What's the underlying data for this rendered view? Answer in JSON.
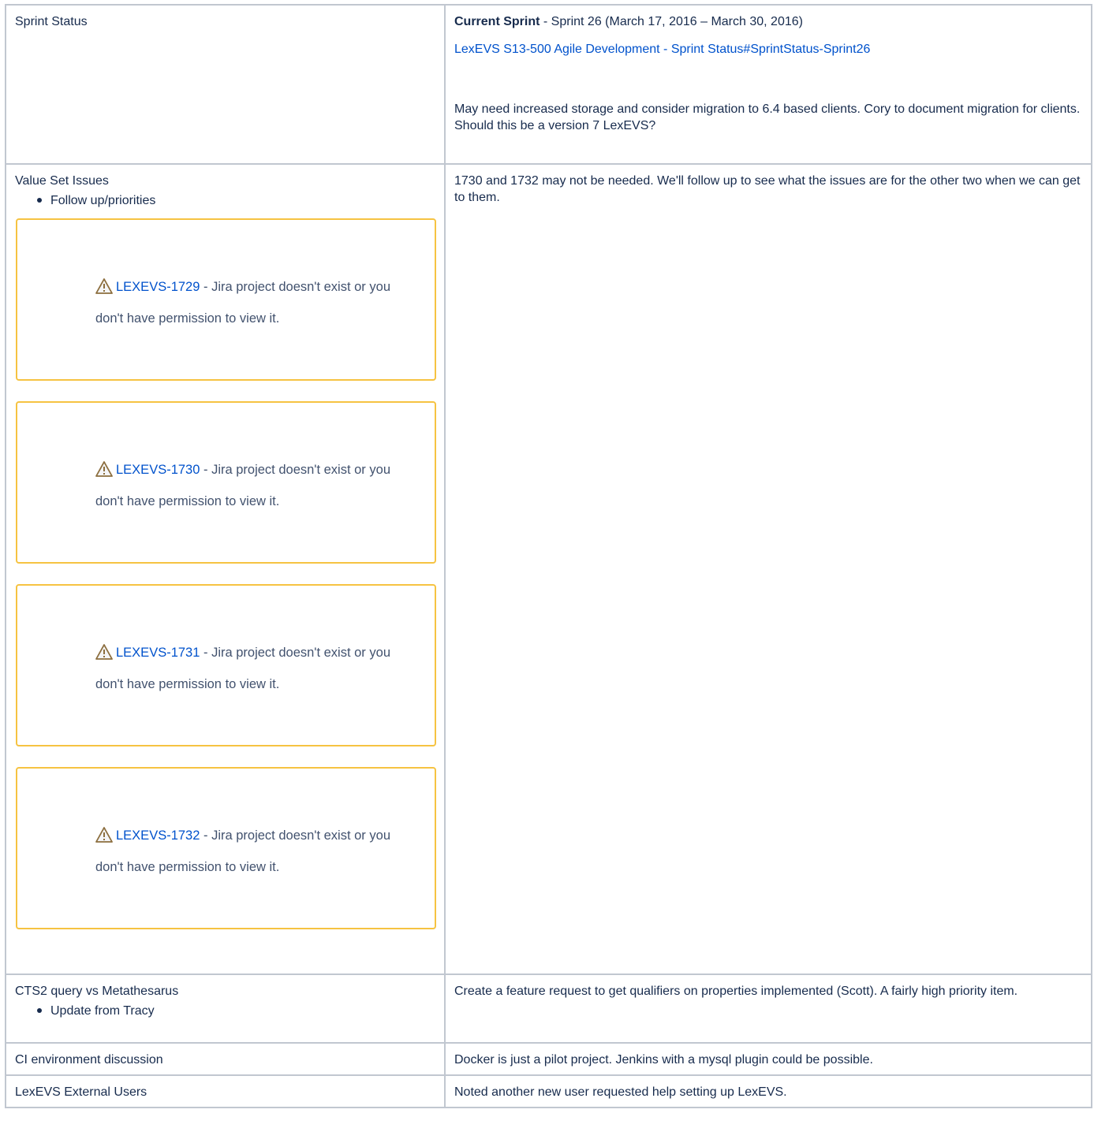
{
  "rows": [
    {
      "topic": "Sprint Status",
      "notes": {
        "current_label": "Current Sprint",
        "current_text": " -  Sprint 26 (March 17, 2016 – March 30, 2016)",
        "link": "LexEVS S13-500 Agile Development - Sprint Status#SprintStatus-Sprint26",
        "para": "May need increased storage and consider migration to 6.4 based clients.  Cory to document migration for clients.  Should this be a version 7 LexEVS?"
      }
    },
    {
      "topic": "Value Set Issues",
      "bullets": [
        "Follow up/priorities"
      ],
      "jira_items": [
        {
          "key": "LEXEVS-1729",
          "message": " - Jira project doesn't exist or you don't have permission to view it."
        },
        {
          "key": "LEXEVS-1730",
          "message": " - Jira project doesn't exist or you don't have permission to view it."
        },
        {
          "key": "LEXEVS-1731",
          "message": " - Jira project doesn't exist or you don't have permission to view it."
        },
        {
          "key": "LEXEVS-1732",
          "message": " - Jira project doesn't exist or you don't have permission to view it."
        }
      ],
      "notes": "1730 and 1732 may not be needed.  We'll follow up to see what the issues are for the other two when we can get to them."
    },
    {
      "topic": "CTS2 query vs Metathesarus",
      "bullets": [
        "Update from Tracy"
      ],
      "notes": "Create a feature request to get qualifiers on properties implemented (Scott).  A fairly high priority item."
    },
    {
      "topic": "CI environment discussion",
      "notes": "Docker is just a pilot project.  Jenkins with a mysql plugin could be possible."
    },
    {
      "topic": "LexEVS External Users",
      "notes": "Noted another new user requested help setting up LexEVS."
    }
  ],
  "colors": {
    "link": "#0052cc",
    "warning_border": "#f6c342",
    "grid": "#c1c7d0"
  },
  "icons": {
    "warning": "warning-icon"
  }
}
